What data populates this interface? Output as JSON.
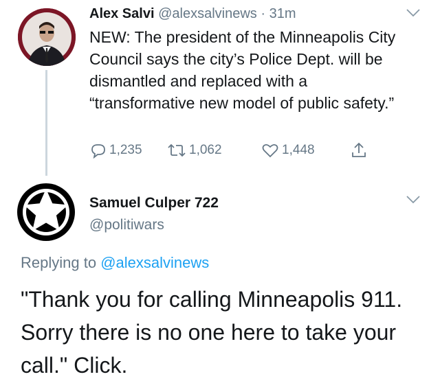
{
  "tweet": {
    "author_name": "Alex Salvi",
    "handle": "@alexsalvinews",
    "separator": "·",
    "time": "31m",
    "text": "NEW: The president of the Minneapolis City Council says the city’s Police Dept. will be dismantled and replaced with a “transformative new model of public safety.”",
    "actions": {
      "reply_count": "1,235",
      "retweet_count": "1,062",
      "like_count": "1,448"
    }
  },
  "reply": {
    "author_name": "Samuel Culper 722",
    "handle": "@politiwars",
    "replying_to_label": "Replying to",
    "replying_to_handle": "@alexsalvinews",
    "text": "\"Thank you for calling Minneapolis 911. Sorry there is no one here to take your call.\" Click."
  },
  "icons": {
    "reply": "speech-bubble-icon",
    "retweet": "retweet-arrows-icon",
    "like": "heart-icon",
    "share": "share-upload-icon",
    "more": "chevron-down-icon"
  },
  "colors": {
    "text": "#14171a",
    "muted": "#657786",
    "link": "#1da1f2",
    "thread_line": "#ccd6dd"
  }
}
